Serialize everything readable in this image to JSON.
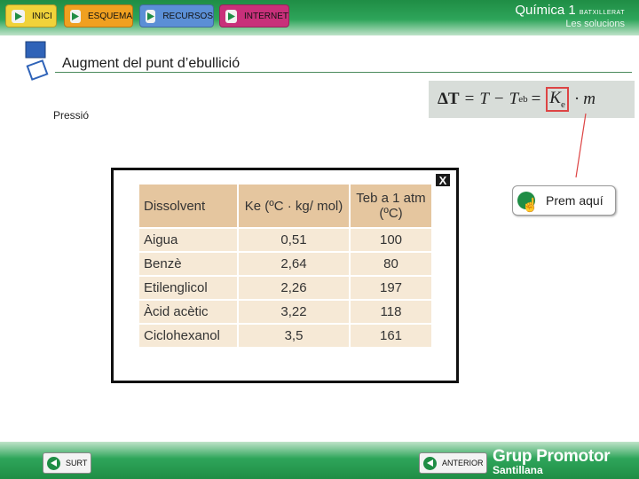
{
  "nav": [
    {
      "label": "INICI",
      "color": "#f0d23a"
    },
    {
      "label": "ESQUEMA",
      "color": "#f0a020"
    },
    {
      "label": "RECURSOS",
      "color": "#5b8fd6"
    },
    {
      "label": "INTERNET",
      "color": "#c8307a"
    }
  ],
  "header": {
    "title": "Química 1",
    "title_small": "BATXILLERAT",
    "subtitle": "Les solucions"
  },
  "page_title": "Augment del punt d’ebullició",
  "label_pressio": "Pressió",
  "formula": {
    "delta": "ΔT",
    "eq1": "=",
    "t": "T",
    "minus": "−",
    "teb": "T",
    "teb_sub": "eb",
    "eq2": "=",
    "k": "K",
    "k_sub": "e",
    "dot": "·",
    "m": "m"
  },
  "popup": {
    "close_label": "X",
    "table": {
      "headers": [
        "Dissolvent",
        "Ke (ºC · kg/ mol)",
        "Teb a 1 atm (ºC)"
      ],
      "rows": [
        [
          "Aigua",
          "0,51",
          "100"
        ],
        [
          "Benzè",
          "2,64",
          "80"
        ],
        [
          "Etilenglicol",
          "2,26",
          "197"
        ],
        [
          "Àcid acètic",
          "3,22",
          "118"
        ],
        [
          "Ciclohexanol",
          "3,5",
          "161"
        ]
      ]
    }
  },
  "prem_button": {
    "label": "Prem aquí"
  },
  "footer": {
    "surt": "SURT",
    "anterior": "ANTERIOR",
    "brand_line1": "Grup Promotor",
    "brand_line2": "Santillana"
  },
  "colors": {
    "accent_green": "#1f8d45",
    "table_header": "#e5c69f",
    "table_cell": "#f6e9d6",
    "highlight": "#d44444"
  }
}
